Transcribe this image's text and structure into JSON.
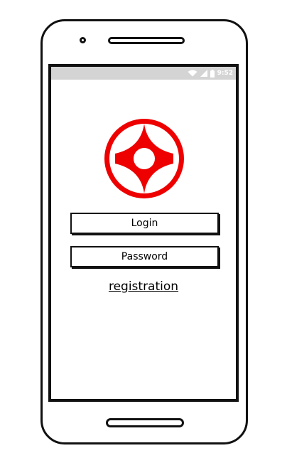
{
  "status_bar": {
    "time": "9:52",
    "icons": [
      "wifi-icon",
      "signal-icon",
      "battery-icon"
    ]
  },
  "logo": {
    "icon": "kyokushin-logo-icon",
    "color": "#ee0000"
  },
  "form": {
    "login_placeholder": "Login",
    "password_placeholder": "Password",
    "registration_link": "registration"
  }
}
